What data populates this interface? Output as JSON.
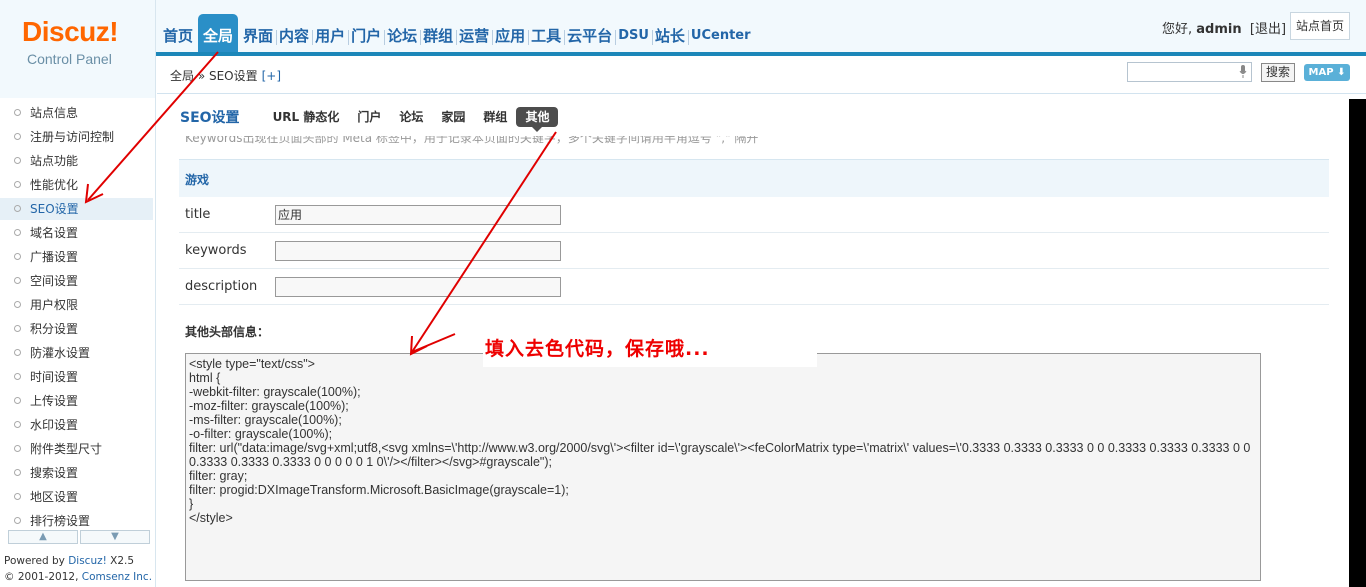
{
  "header": {
    "logo_brand": "Discuz!",
    "logo_sub": "Control Panel",
    "nav": [
      "首页",
      "全局",
      "界面",
      "内容",
      "用户",
      "门户",
      "论坛",
      "群组",
      "运营",
      "应用",
      "工具",
      "云平台",
      "DSU",
      "站长",
      "UCenter"
    ],
    "active_nav_index": 1,
    "greeting_prefix": "您好, ",
    "username": "admin",
    "logout": "[退出]",
    "site_home": "站点首页"
  },
  "subbar": {
    "breadcrumb": "全局 » SEO设置",
    "add": "[+]",
    "search_button": "搜索",
    "map_button": "MAP"
  },
  "sidebar": {
    "items": [
      "站点信息",
      "注册与访问控制",
      "站点功能",
      "性能优化",
      "SEO设置",
      "域名设置",
      "广播设置",
      "空间设置",
      "用户权限",
      "积分设置",
      "防灌水设置",
      "时间设置",
      "上传设置",
      "水印设置",
      "附件类型尺寸",
      "搜索设置",
      "地区设置",
      "排行榜设置"
    ],
    "active_index": 4,
    "powered_prefix": "Powered by ",
    "powered_brand": "Discuz!",
    "powered_version": " X2.5",
    "copyright_prefix": "© 2001-2012, ",
    "copyright_company": "Comsenz Inc."
  },
  "main": {
    "heading": "SEO设置",
    "tabs": [
      "URL 静态化",
      "门户",
      "论坛",
      "家园",
      "群组",
      "其他"
    ],
    "active_tab_index": 5,
    "cut_text": "Keywords出现在页面头部的 Meta 标签中，用于记录本页面的关键字，多个关键字间请用半角逗号 \",\" 隔开",
    "section_title": "游戏",
    "fields": [
      {
        "label": "title",
        "value": "应用"
      },
      {
        "label": "keywords",
        "value": ""
      },
      {
        "label": "description",
        "value": ""
      }
    ],
    "extra_head_label": "其他头部信息：",
    "code": "<style type=\"text/css\">\nhtml {\n-webkit-filter: grayscale(100%);\n-moz-filter: grayscale(100%);\n-ms-filter: grayscale(100%);\n-o-filter: grayscale(100%);\nfilter: url(\"data:image/svg+xml;utf8,<svg xmlns=\\'http://www.w3.org/2000/svg\\'><filter id=\\'grayscale\\'><feColorMatrix type=\\'matrix\\' values=\\'0.3333 0.3333 0.3333 0 0 0.3333 0.3333 0.3333 0 0 0.3333 0.3333 0.3333 0 0 0 0 0 1 0\\'/></filter></svg>#grayscale\");\nfilter: gray;\nfilter: progid:DXImageTransform.Microsoft.BasicImage(grayscale=1);\n}\n</style>",
    "callout": "填入去色代码，保存哦..."
  },
  "colors": {
    "accent": "#2a8fc7",
    "link": "#2366a8",
    "annotation": "#e00000"
  }
}
